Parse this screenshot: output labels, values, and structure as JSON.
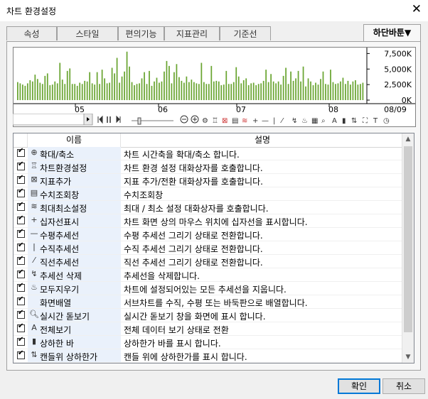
{
  "window": {
    "title": "차트 환경설정"
  },
  "tabs": [
    {
      "label": "속성"
    },
    {
      "label": "스타일"
    },
    {
      "label": "편의기능"
    },
    {
      "label": "지표관리"
    },
    {
      "label": "기준선"
    }
  ],
  "right_tab": {
    "label": "하단바툰▼"
  },
  "chart_data": {
    "type": "bar",
    "x_tick_labels": [
      "05",
      "06",
      "07",
      "08",
      "08/09"
    ],
    "y_tick_labels": [
      "7,500K",
      "5,000K",
      "2,500K",
      "0K"
    ],
    "ylim": [
      0,
      8000000
    ],
    "bar_color": "#6aa532",
    "values": [
      2900000,
      2700000,
      2500000,
      2300000,
      2700000,
      3200000,
      3000000,
      4100000,
      3400000,
      2800000,
      2600000,
      3900000,
      4300000,
      2400000,
      2500000,
      3000000,
      2700000,
      6000000,
      3300000,
      2600000,
      4700000,
      5100000,
      2600000,
      2600000,
      2300000,
      2800000,
      2600000,
      3100000,
      3000000,
      4500000,
      2700000,
      2500000,
      4500000,
      2600000,
      4900000,
      3500000,
      2700000,
      2800000,
      5200000,
      4300000,
      6800000,
      2800000,
      3800000,
      4600000,
      7800000,
      5400000,
      2900000,
      2400000,
      2600000,
      2700000,
      3500000,
      4500000,
      2600000,
      4700000,
      2300000,
      3000000,
      3600000,
      2800000,
      3000000,
      4600000,
      6300000,
      5500000,
      2700000,
      4500000,
      5800000,
      3700000,
      3100000,
      2800000,
      3800000,
      2900000,
      3300000,
      2900000,
      2700000,
      2600000,
      6000000,
      2900000,
      2600000,
      2600000,
      5500000,
      3000000,
      3100000,
      3000000,
      2400000,
      2500000,
      4700000,
      2600000,
      2600000,
      2900000,
      5300000,
      3800000,
      2700000,
      3200000,
      3500000,
      2400000,
      2700000,
      2800000,
      2400000,
      2600000,
      2700000,
      3100000,
      4900000,
      2900000,
      4200000,
      3000000,
      2700000,
      3000000,
      2500000,
      3900000,
      5200000,
      2600000,
      4600000,
      3100000,
      3500000,
      4700000,
      3000000,
      5400000,
      2200000,
      3500000,
      3000000,
      2400000,
      2800000,
      2500000,
      3400000,
      4600000,
      2600000,
      2500000,
      4900000,
      2900000,
      2600000,
      2700000,
      3000000,
      3600000,
      2600000,
      3100000,
      2500000,
      3000000,
      3200000,
      2500000,
      2600000,
      2800000
    ]
  },
  "table": {
    "headers": {
      "name": "이름",
      "desc": "설명"
    },
    "rows": [
      {
        "icon": "⊕",
        "name": "확대/축소",
        "desc": "차트 시간축을 확대/축소 합니다."
      },
      {
        "icon": "♖",
        "name": "차트환경설정",
        "desc": "차트 환경 설정 대화상자를 호출합니다."
      },
      {
        "icon": "⊠",
        "name": "지표추가",
        "desc": "지표 추가/전환 대화상자를 호출합니다."
      },
      {
        "icon": "▤",
        "name": "수치조회창",
        "desc": "수치조회창"
      },
      {
        "icon": "≋",
        "name": "최대최소설정",
        "desc": "최대 / 최소 설정 대화상자를 호출합니다."
      },
      {
        "icon": "+",
        "name": "십자선표시",
        "desc": "차트 화면 상의 마우스 위치에 십자선을 표시합니다."
      },
      {
        "icon": "—",
        "name": "수평추세선",
        "desc": "수평 추세선 그리기 상태로 전환합니다."
      },
      {
        "icon": "|",
        "name": "수직추세선",
        "desc": "수직 추세선 그리기 상태로 전환합니다."
      },
      {
        "icon": "⁄",
        "name": "직선추세선",
        "desc": "직선 추세선 그리기 상태로 전환합니다."
      },
      {
        "icon": "↯",
        "name": "추세선 삭제",
        "desc": "추세선을 삭제합니다."
      },
      {
        "icon": "♨",
        "name": "모두지우기",
        "desc": "차트에 설정되어있는 모든 추세선을 지웁니다."
      },
      {
        "icon": "",
        "name": "화면배열",
        "desc": "서브차트를 수직, 수평 또는 바둑판으로 배열합니다."
      },
      {
        "icon": "🔍︎",
        "name": "실시간 돋보기",
        "desc": "실시간 돋보기 창을 화면에 표시 합니다."
      },
      {
        "icon": "A",
        "name": "전체보기",
        "desc": "전체 데이터 보기 상태로 전환"
      },
      {
        "icon": "▮",
        "name": "상하한 바",
        "desc": "상하한가 바를 표시 합니다."
      },
      {
        "icon": "⇅",
        "name": "캔들위 상하한가",
        "desc": "캔들 위에 상하한가를 표시 합니다."
      }
    ]
  },
  "buttons": {
    "ok": "확인",
    "cancel": "취소"
  }
}
